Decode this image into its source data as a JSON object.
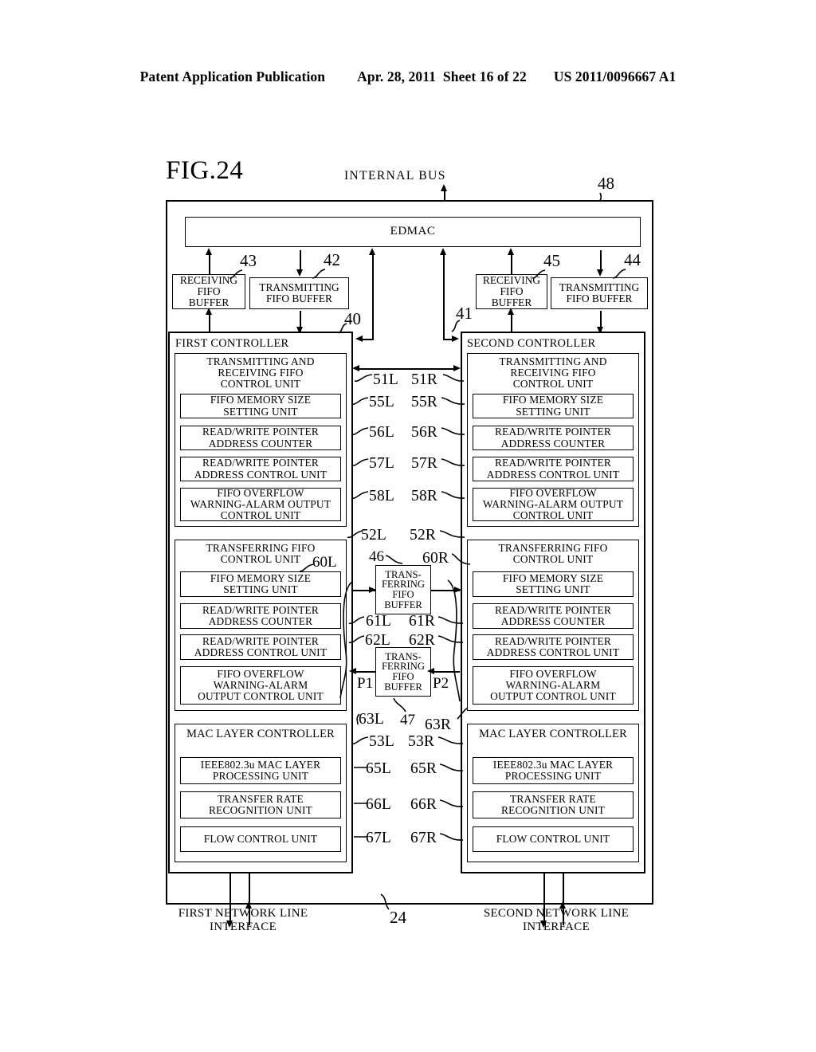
{
  "header": {
    "publication": "Patent Application Publication",
    "date": "Apr. 28, 2011",
    "sheet": "Sheet 16 of 22",
    "docnum": "US 2011/0096667 A1"
  },
  "figure": {
    "title": "FIG.24",
    "bus_label": "INTERNAL BUS",
    "outer_ref": "48",
    "device_ref": "24"
  },
  "edmac": {
    "label": "EDMAC"
  },
  "buffers": {
    "left_receiving": {
      "label": "RECEIVING\nFIFO\nBUFFER",
      "ref": "43"
    },
    "left_transmitting": {
      "label": "TRANSMITTING\nFIFO BUFFER",
      "ref": "42"
    },
    "right_receiving": {
      "label": "RECEIVING\nFIFO\nBUFFER",
      "ref": "45"
    },
    "right_transmitting": {
      "label": "TRANSMITTING\nFIFO BUFFER",
      "ref": "44"
    }
  },
  "controllers": {
    "left": {
      "name": "FIRST CONTROLLER",
      "ref": "40"
    },
    "right": {
      "name": "SECOND CONTROLLER",
      "ref": "41"
    }
  },
  "group_titles": {
    "txrx_fifo": "TRANSMITTING AND\nRECEIVING FIFO\nCONTROL UNIT",
    "transferring_fifo": "TRANSFERRING FIFO\nCONTROL UNIT",
    "mac_layer": "MAC LAYER CONTROLLER"
  },
  "units": {
    "fifo_memory_size": "FIFO MEMORY SIZE\nSETTING UNIT",
    "rw_pointer_counter": "READ/WRITE POINTER\nADDRESS COUNTER",
    "rw_pointer_control": "READ/WRITE POINTER\nADDRESS CONTROL UNIT",
    "overflow_alarm_a": "FIFO OVERFLOW\nWARNING-ALARM OUTPUT\nCONTROL UNIT",
    "overflow_alarm_b": "FIFO OVERFLOW\nWARNING-ALARM\nOUTPUT CONTROL UNIT",
    "ieee_mac": "IEEE802.3u MAC LAYER\nPROCESSING UNIT",
    "transfer_rate": "TRANSFER RATE\nRECOGNITION UNIT",
    "flow_control": "FLOW CONTROL UNIT"
  },
  "transferring_buffers": {
    "upper": {
      "label": "TRANS-\nFERRING\nFIFO\nBUFFER",
      "ref": "46"
    },
    "lower": {
      "label": "TRANS-\nFERRING\nFIFO\nBUFFER",
      "ref": "47"
    },
    "port_left": "P1",
    "port_right": "P2"
  },
  "refs": {
    "txrx_L": "51L",
    "txrx_R": "51R",
    "memsize1_L": "55L",
    "memsize1_R": "55R",
    "counter1_L": "56L",
    "counter1_R": "56R",
    "ptrctrl1_L": "57L",
    "ptrctrl1_R": "57R",
    "alarm1_L": "58L",
    "alarm1_R": "58R",
    "xfer_L": "52L",
    "xfer_R": "52R",
    "memsize2_L": "60L",
    "memsize2_R": "60R",
    "counter2_L": "61L",
    "counter2_R": "61R",
    "ptrctrl2_L": "62L",
    "ptrctrl2_R": "62R",
    "alarm2_L": "63L",
    "alarm2_R": "63R",
    "mac_L": "53L",
    "mac_R": "53R",
    "ieee_L": "65L",
    "ieee_R": "65R",
    "rate_L": "66L",
    "rate_R": "66R",
    "flow_L": "67L",
    "flow_R": "67R"
  },
  "network": {
    "left": "FIRST NETWORK LINE\nINTERFACE",
    "right": "SECOND NETWORK LINE\nINTERFACE"
  }
}
